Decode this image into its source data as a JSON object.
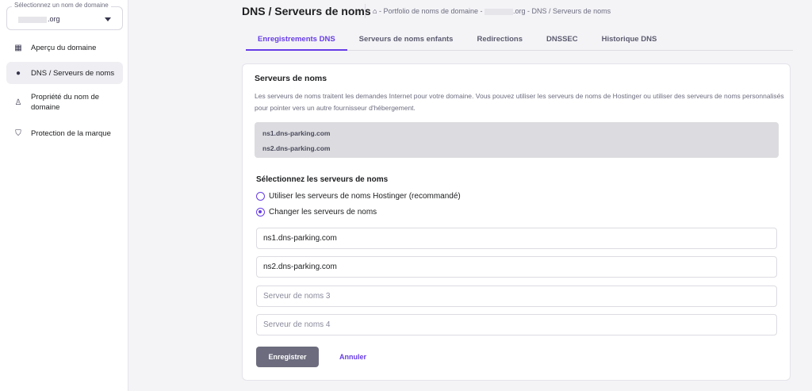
{
  "sidebar": {
    "domain_select": {
      "label": "Sélectionnez un nom de domaine",
      "value": ".org"
    },
    "items": [
      {
        "label": "Aperçu du domaine",
        "icon": "grid-icon"
      },
      {
        "label": "DNS / Serveurs de noms",
        "icon": "dns-icon",
        "active": true
      },
      {
        "label": "Propriété du nom de domaine",
        "icon": "user-icon"
      },
      {
        "label": "Protection de la marque",
        "icon": "shield-icon"
      }
    ]
  },
  "header": {
    "title": "DNS / Serveurs de noms",
    "breadcrumb": {
      "part1": "- Portfolio de noms de domaine -",
      "part2": ".org - DNS / Serveurs de noms"
    }
  },
  "tabs": [
    "Enregistrements DNS",
    "Serveurs de noms enfants",
    "Redirections",
    "DNSSEC",
    "Historique DNS"
  ],
  "card": {
    "title": "Serveurs de noms",
    "description": "Les serveurs de noms traitent les demandes Internet pour votre domaine. Vous pouvez utiliser les serveurs de noms de Hostinger ou utiliser des serveurs de noms personnalisés pour pointer vers un autre fournisseur d'hébergement.",
    "current": [
      "ns1.dns-parking.com",
      "ns2.dns-parking.com"
    ],
    "select_title": "Sélectionnez les serveurs de noms",
    "options": [
      "Utiliser les serveurs de noms Hostinger (recommandé)",
      "Changer les serveurs de noms"
    ],
    "inputs": [
      {
        "value": "ns1.dns-parking.com",
        "placeholder": ""
      },
      {
        "value": "ns2.dns-parking.com",
        "placeholder": ""
      },
      {
        "value": "",
        "placeholder": "Serveur de noms 3"
      },
      {
        "value": "",
        "placeholder": "Serveur de noms 4"
      }
    ],
    "save": "Enregistrer",
    "cancel": "Annuler"
  },
  "colors": {
    "accent": "#673de6"
  }
}
